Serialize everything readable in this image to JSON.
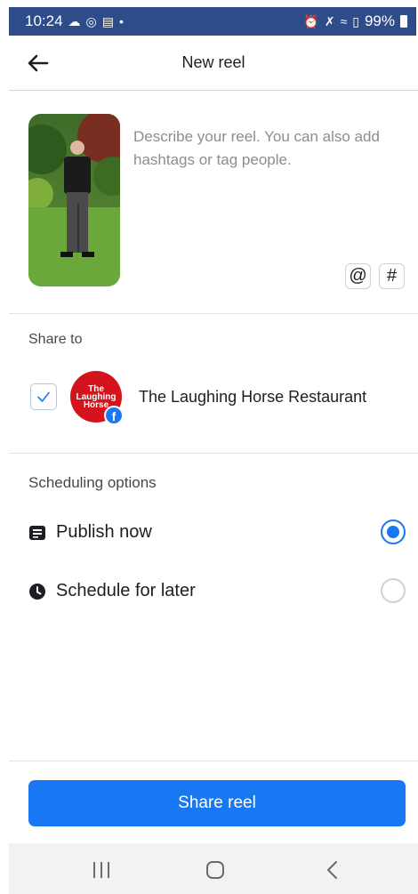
{
  "status_bar": {
    "time": "10:24",
    "battery": "99%",
    "left_icons": [
      "snapchat-icon",
      "alarm-clock-icon",
      "news-icon",
      "dot-icon"
    ],
    "right_icons": [
      "alarm-icon",
      "mute-icon",
      "wifi-icon",
      "signal-icon",
      "battery-icon"
    ]
  },
  "header": {
    "title": "New reel",
    "back_icon": "arrow-left-icon"
  },
  "reel": {
    "caption_placeholder": "Describe your reel. You can also add hashtags or tag people.",
    "caption_value": "",
    "mention_label": "@",
    "hashtag_label": "#"
  },
  "share_to": {
    "heading": "Share to",
    "checked": true,
    "page_name": "The Laughing Horse Restaurant",
    "avatar_text": [
      "The",
      "Laughing",
      "Horse"
    ],
    "badge_icon": "facebook-icon"
  },
  "scheduling": {
    "heading": "Scheduling options",
    "options": [
      {
        "label": "Publish now",
        "icon": "calendar-list-icon",
        "selected": true
      },
      {
        "label": "Schedule for later",
        "icon": "clock-icon",
        "selected": false
      }
    ]
  },
  "share_button": {
    "label": "Share reel"
  },
  "nav_bar": {
    "buttons": [
      "recent-apps-icon",
      "home-icon",
      "back-icon"
    ]
  },
  "colors": {
    "accent": "#1877f2",
    "status_bar": "#2e4c8a",
    "avatar_red": "#d4131c"
  }
}
